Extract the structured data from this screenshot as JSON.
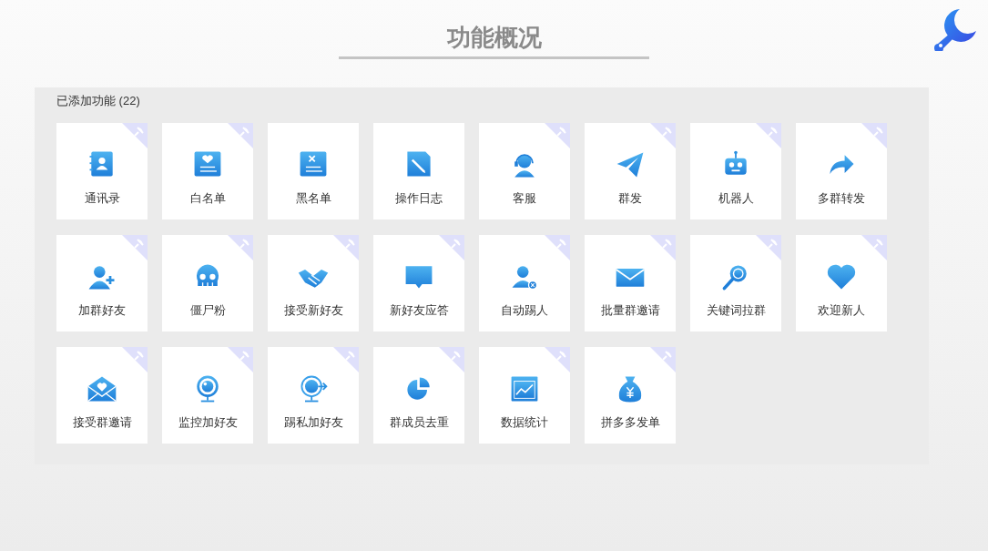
{
  "title": "功能概况",
  "section": {
    "heading": "已添加功能 (22)",
    "features": [
      {
        "label": "通讯录",
        "kind": "contacts",
        "pinned": true
      },
      {
        "label": "白名单",
        "kind": "whitelist",
        "pinned": true
      },
      {
        "label": "黑名单",
        "kind": "blacklist",
        "pinned": false
      },
      {
        "label": "操作日志",
        "kind": "log",
        "pinned": false
      },
      {
        "label": "客服",
        "kind": "support",
        "pinned": true
      },
      {
        "label": "群发",
        "kind": "send",
        "pinned": true
      },
      {
        "label": "机器人",
        "kind": "robot",
        "pinned": true
      },
      {
        "label": "多群转发",
        "kind": "forward",
        "pinned": true
      },
      {
        "label": "加群好友",
        "kind": "adduser",
        "pinned": true
      },
      {
        "label": "僵尸粉",
        "kind": "skull",
        "pinned": true
      },
      {
        "label": "接受新好友",
        "kind": "handshake",
        "pinned": true
      },
      {
        "label": "新好友应答",
        "kind": "chat",
        "pinned": true
      },
      {
        "label": "自动踢人",
        "kind": "kick",
        "pinned": true
      },
      {
        "label": "批量群邀请",
        "kind": "mail",
        "pinned": true
      },
      {
        "label": "关键词拉群",
        "kind": "search",
        "pinned": true
      },
      {
        "label": "欢迎新人",
        "kind": "heart",
        "pinned": true
      },
      {
        "label": "接受群邀请",
        "kind": "openmail",
        "pinned": true
      },
      {
        "label": "监控加好友",
        "kind": "webcam",
        "pinned": true
      },
      {
        "label": "踢私加好友",
        "kind": "webcamout",
        "pinned": true
      },
      {
        "label": "群成员去重",
        "kind": "pie",
        "pinned": true
      },
      {
        "label": "数据统计",
        "kind": "chart",
        "pinned": true
      },
      {
        "label": "拼多多发单",
        "kind": "moneybag",
        "pinned": true
      }
    ]
  }
}
